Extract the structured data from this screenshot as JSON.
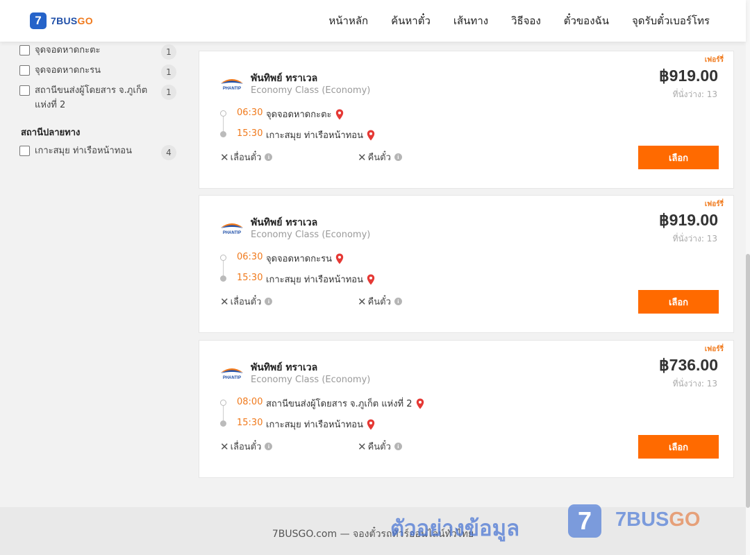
{
  "header": {
    "logo_badge": "7",
    "logo_brand": "7BUS",
    "logo_brand_accent": "GO",
    "nav": [
      "หน้าหลัก",
      "ค้นหาตั๋ว",
      "เส้นทาง",
      "วิธีจอง",
      "ตั๋วของฉัน",
      "จุดรับตั๋วเบอร์โทร"
    ]
  },
  "sidebar": {
    "origin_items": [
      {
        "label": "จุดจอดหาดกะตะ",
        "count": "1"
      },
      {
        "label": "จุดจอดหาดกะรน",
        "count": "1"
      },
      {
        "label": "สถานีขนส่งผู้โดยสาร จ.ภูเก็ต แห่งที่ 2",
        "count": "1"
      }
    ],
    "destination_title": "สถานีปลายทาง",
    "destination_items": [
      {
        "label": "เกาะสมุย ท่าเรือหน้าทอน",
        "count": "4"
      }
    ]
  },
  "results": [
    {
      "promo": "เฟอร์รี่",
      "operator": "พันทิพย์ ทราเวล",
      "class": "Economy Class (Economy)",
      "price": "฿919.00",
      "seats": "ที่นั่งว่าง: 13",
      "depart_time": "06:30",
      "depart_place": "จุดจอดหาดกะตะ",
      "arrive_time": "15:30",
      "arrive_place": "เกาะสมุย ท่าเรือหน้าทอน",
      "reschedule": "เลื่อนตั๋ว",
      "refund": "คืนตั๋ว",
      "select": "เลือก"
    },
    {
      "promo": "เฟอร์รี่",
      "operator": "พันทิพย์ ทราเวล",
      "class": "Economy Class (Economy)",
      "price": "฿919.00",
      "seats": "ที่นั่งว่าง: 13",
      "depart_time": "06:30",
      "depart_place": "จุดจอดหาดกะรน",
      "arrive_time": "15:30",
      "arrive_place": "เกาะสมุย ท่าเรือหน้าทอน",
      "reschedule": "เลื่อนตั๋ว",
      "refund": "คืนตั๋ว",
      "select": "เลือก"
    },
    {
      "promo": "เฟอร์รี่",
      "operator": "พันทิพย์ ทราเวล",
      "class": "Economy Class (Economy)",
      "price": "฿736.00",
      "seats": "ที่นั่งว่าง: 13",
      "depart_time": "08:00",
      "depart_place": "สถานีขนส่งผู้โดยสาร จ.ภูเก็ต แห่งที่ 2",
      "arrive_time": "15:30",
      "arrive_place": "เกาะสมุย ท่าเรือหน้าทอน",
      "reschedule": "เลื่อนตั๋ว",
      "refund": "คืนตั๋ว",
      "select": "เลือก"
    }
  ],
  "operator_logo_text": "PHANTIP",
  "footer": {
    "text": "7BUSGO.com — จองตั๋วรถทัวร์ออนไลน์ทั่วไทย"
  },
  "watermark": {
    "caption": "ตัวอย่างข้อมูล",
    "badge": "7",
    "brand": "7BUS",
    "brand_accent": "GO"
  },
  "colors": {
    "accent": "#ff6a00",
    "brand_blue": "#2563c9",
    "time_orange": "#f07a1d",
    "pin_red": "#e53935"
  },
  "icons": {
    "pin": "map-pin-icon",
    "cross": "x-icon",
    "info": "info-icon"
  }
}
